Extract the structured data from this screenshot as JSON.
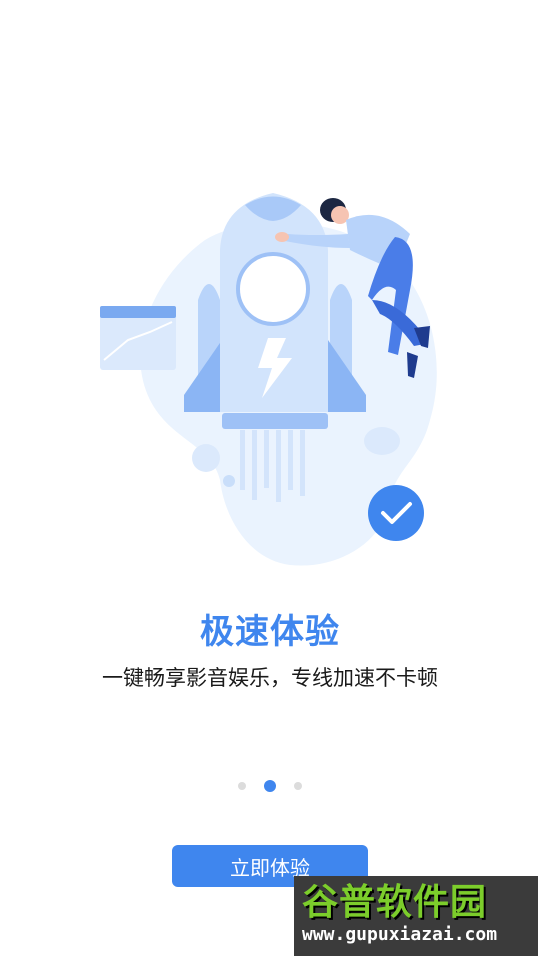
{
  "onboarding": {
    "title": "极速体验",
    "subtitle": "一键畅享影音娱乐，专线加速不卡顿",
    "pager": {
      "total": 3,
      "current": 2
    },
    "cta_label": "立即体验"
  },
  "illustration": {
    "icons": [
      "rocket-icon",
      "lightning-icon",
      "person-icon",
      "chart-card-icon",
      "check-icon"
    ],
    "colors": {
      "primary": "#3f86ee",
      "light": "#eaf3fe",
      "mid": "#b9d4fa",
      "dark": "#2a5cc7"
    }
  },
  "watermark": {
    "brand": "谷普软件园",
    "url": "www.gupuxiazai.com"
  }
}
